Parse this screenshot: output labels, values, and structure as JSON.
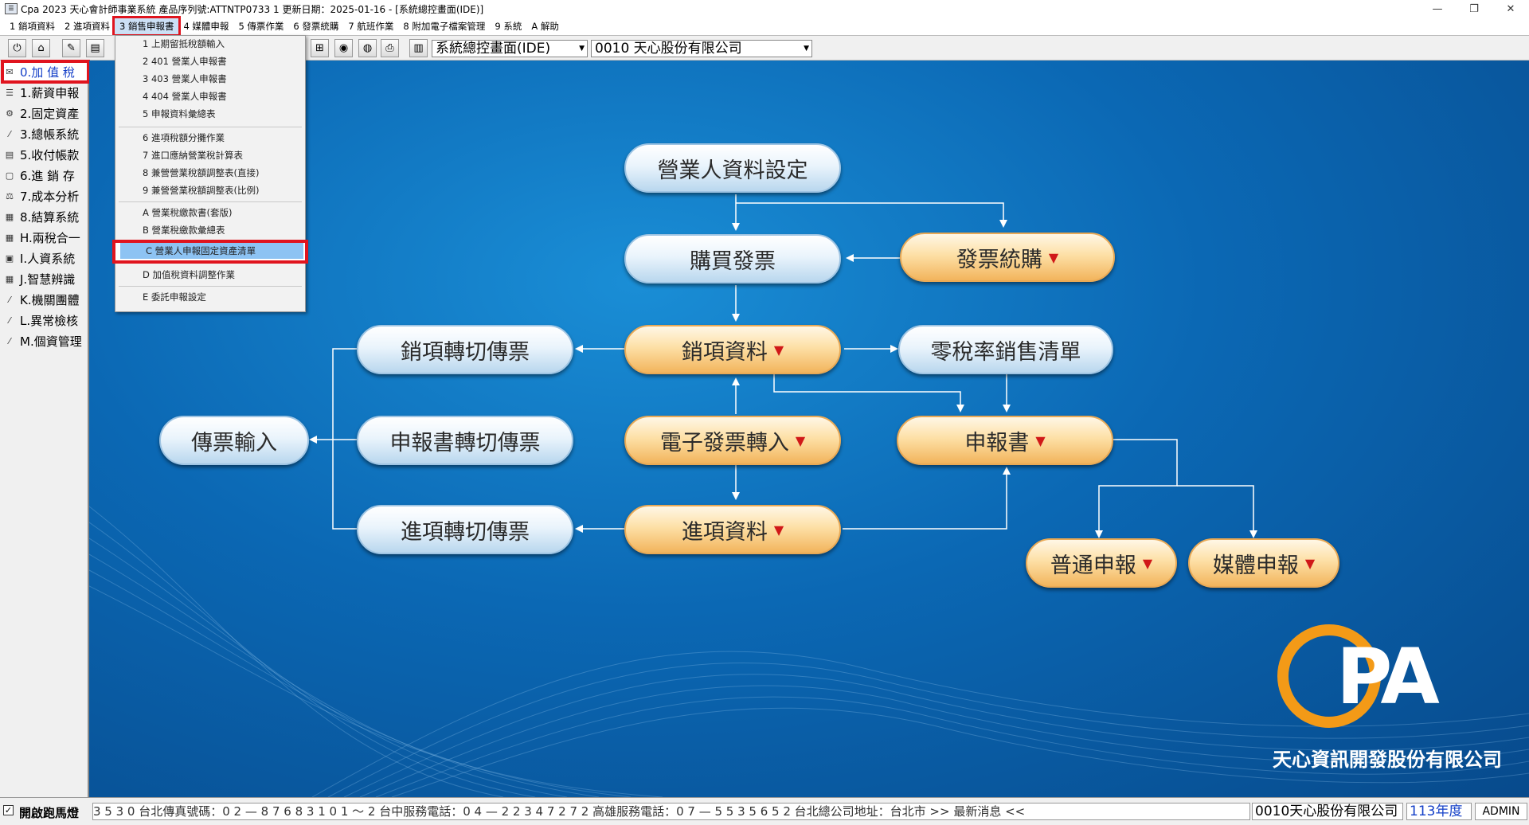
{
  "window": {
    "title": "Cpa 2023  天心會計師事業系統  產品序列號:ATTNTP0733 1    更新日期：2025-01-16 - [系統總控畫面(IDE)]",
    "controls": [
      "—",
      "❐",
      "✕"
    ]
  },
  "menubar": {
    "items": [
      "1 銷項資料",
      "2 進項資料",
      "3 銷售申報書",
      "4 媒體申報",
      "5 傳票作業",
      "6 發票統購",
      "7 航班作業",
      "8 附加電子檔案管理",
      "9 系統",
      "A 解助"
    ],
    "active_index": 2
  },
  "toolbar": {
    "screen_select": "系統總控畫面(IDE)",
    "company_select": "0010  天心股份有限公司"
  },
  "sidebar": {
    "items": [
      {
        "label": "0.加 值 稅",
        "icon": "tax-icon"
      },
      {
        "label": "1.薪資申報",
        "icon": "payroll-icon"
      },
      {
        "label": "2.固定資產",
        "icon": "asset-icon"
      },
      {
        "label": "3.總帳系統",
        "icon": "ledger-icon"
      },
      {
        "label": "5.收付帳款",
        "icon": "payment-icon"
      },
      {
        "label": "6.進 銷 存",
        "icon": "inventory-icon"
      },
      {
        "label": "7.成本分析",
        "icon": "cost-icon"
      },
      {
        "label": "8.結算系統",
        "icon": "settlement-icon"
      },
      {
        "label": "H.兩稅合一",
        "icon": "tax-merge-icon"
      },
      {
        "label": "I.人資系統",
        "icon": "hr-icon"
      },
      {
        "label": "J.智慧辨識",
        "icon": "recognition-icon"
      },
      {
        "label": "K.機關團體",
        "icon": "organization-icon"
      },
      {
        "label": "L.異常檢核",
        "icon": "check-icon"
      },
      {
        "label": "M.個資管理",
        "icon": "privacy-icon"
      }
    ],
    "active_index": 0
  },
  "dropdown": {
    "items": [
      "1 上期留抵稅額輸入",
      "2 401 營業人申報書",
      "3 403 營業人申報書",
      "4 404 營業人申報書",
      "5 申報資料彙總表",
      "6 進項稅額分攤作業",
      "7 進口應納營業稅計算表",
      "8 兼營營業稅額調整表(直接)",
      "9 兼營營業稅額調整表(比例)",
      "A 營業稅繳款書(套版)",
      "B 營業稅繳款彙總表",
      "C 營業人申報固定資產清單",
      "D 加值稅資料調整作業",
      "E 委託申報設定"
    ],
    "highlight_index": 11
  },
  "flowchart": {
    "nodes": {
      "business_setup": "營業人資料設定",
      "purchase_invoice": "購買發票",
      "invoice_bulk_purchase": "發票統購",
      "sales_data": "銷項資料",
      "zero_tax_list": "零稅率銷售清單",
      "sales_voucher": "銷項轉切傳票",
      "voucher_input": "傳票輸入",
      "report_voucher": "申報書轉切傳票",
      "einvoice_import": "電子發票轉入",
      "tax_report": "申報書",
      "purchase_voucher": "進項轉切傳票",
      "purchase_data": "進項資料",
      "normal_filing": "普通申報",
      "media_filing": "媒體申報"
    },
    "dropdown_marker": "▼"
  },
  "logo": {
    "letters": "PA",
    "company": "天心資訊開發股份有限公司",
    "ring_color": "#f39a17"
  },
  "statusbar": {
    "checkbox_checked": true,
    "marquee_label": "開啟跑馬燈",
    "marquee_text": "3 5 3 0          台北傳真號碼：0 2 — 8 7 6 8 3 1 0 1 ～ 2            台中服務電話：0 4 — 2 2 3 4 7 2 7 2            高雄服務電話：0 7 — 5 5 3 5 6 5 2            台北總公司地址：台北市 >> 最新消息 <<",
    "company": "0010天心股份有限公司",
    "year": "113年度",
    "user": "ADMIN"
  },
  "colors": {
    "highlight_red": "#e0141e",
    "canvas_blue": "#0b68b4",
    "node_orange": "#fde0a6",
    "node_blue": "#eaf4fc",
    "year_blue": "#1540c8"
  }
}
